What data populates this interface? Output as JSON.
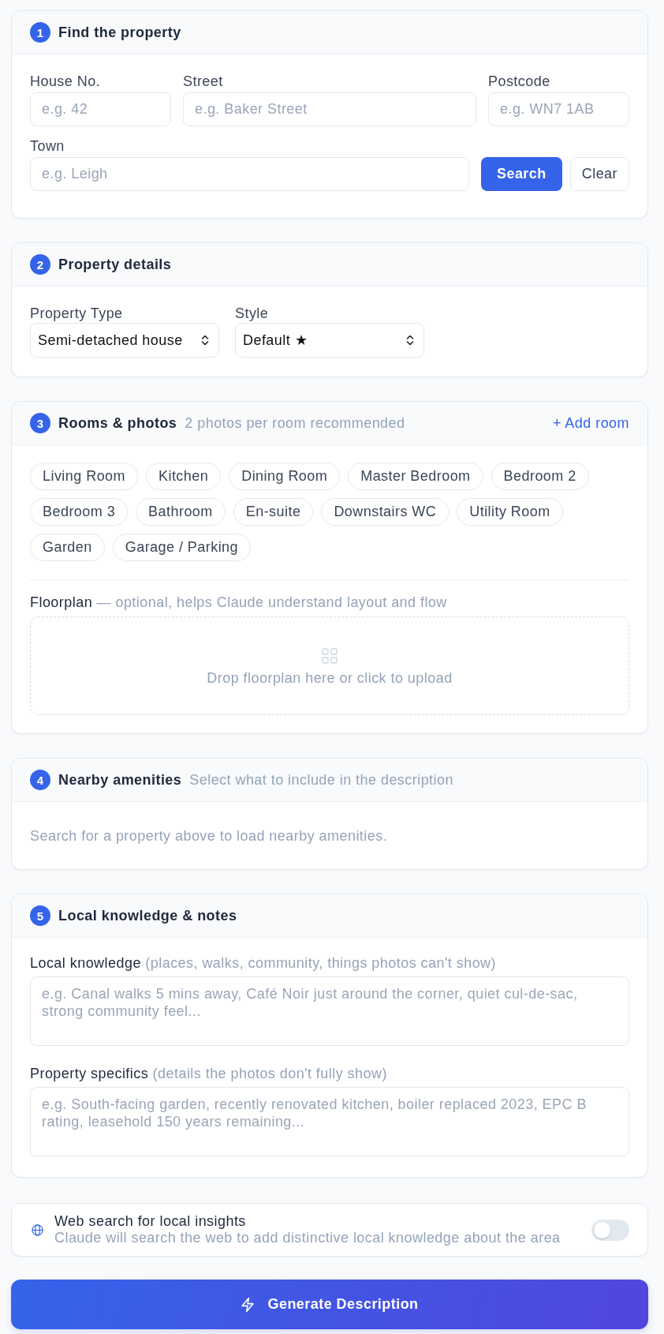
{
  "find_property": {
    "step": "1",
    "title": "Find the property",
    "fields": [
      {
        "label": "House No.",
        "placeholder": "e.g. 42"
      },
      {
        "label": "Street",
        "placeholder": "e.g. Baker Street"
      },
      {
        "label": "Postcode",
        "placeholder": "e.g. WN7 1AB"
      },
      {
        "label": "Town",
        "placeholder": "e.g. Leigh"
      }
    ],
    "buttons": [
      {
        "label": "Search",
        "kind": "primary"
      },
      {
        "label": "Clear",
        "kind": "secondary"
      }
    ]
  },
  "property_details": {
    "step": "2",
    "title": "Property details",
    "selects": [
      {
        "label": "Property Type",
        "value": "Semi-detached house"
      },
      {
        "label": "Style",
        "value": "Default ★"
      }
    ]
  },
  "rooms": {
    "step": "3",
    "title": "Rooms & photos",
    "hint": "2 photos per room recommended",
    "add_button": "+ Add room",
    "chips": [
      "Living Room",
      "Kitchen",
      "Dining Room",
      "Master Bedroom",
      "Bedroom 2",
      "Bedroom 3",
      "Bathroom",
      "En-suite",
      "Downstairs WC",
      "Utility Room",
      "Garden",
      "Garage / Parking"
    ],
    "floorplan": {
      "label": "Floorplan",
      "hint": "— optional, helps Claude understand layout and flow",
      "dropzone": "Drop floorplan here or click to upload"
    }
  },
  "amenities": {
    "step": "4",
    "title": "Nearby amenities",
    "hint": "Select what to include in the description",
    "empty_message": "Search for a property above to load nearby amenities."
  },
  "notes": {
    "step": "5",
    "title": "Local knowledge & notes",
    "fields": [
      {
        "label": "Local knowledge",
        "hint": "(places, walks, community, things photos can't show)",
        "placeholder": "e.g. Canal walks 5 mins away, Café Noir just around the corner, quiet cul-de-sac, strong community feel..."
      },
      {
        "label": "Property specifics",
        "hint": "(details the photos don't fully show)",
        "placeholder": "e.g. South-facing garden, recently renovated kitchen, boiler replaced 2023, EPC B rating, leasehold 150 years remaining..."
      }
    ]
  },
  "web_search": {
    "title": "Web search for local insights",
    "description": "Claude will search the web to add distinctive local knowledge about the area",
    "on": false
  },
  "generate_button": "Generate Description"
}
